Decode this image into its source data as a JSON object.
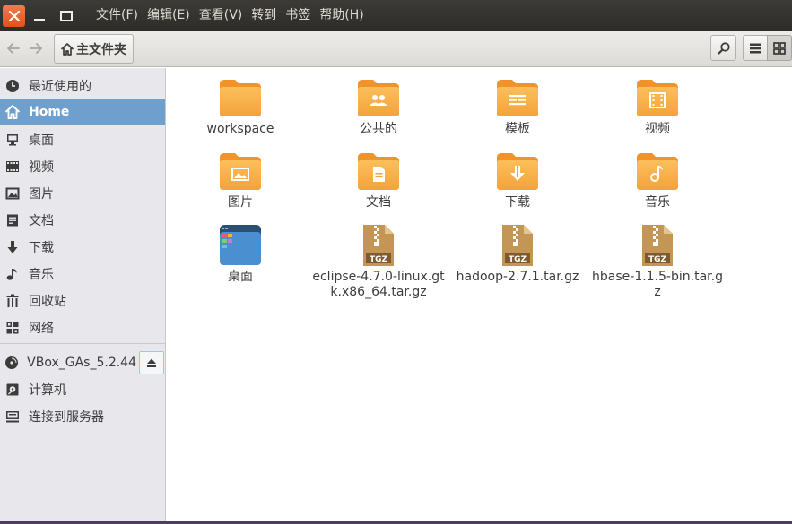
{
  "menubar": {
    "items": [
      "文件(F)",
      "编辑(E)",
      "查看(V)",
      "转到",
      "书签",
      "帮助(H)"
    ]
  },
  "toolbar": {
    "path_label": "主文件夹"
  },
  "sidebar": {
    "items": [
      {
        "label": "最近使用的",
        "icon": "clock-icon"
      },
      {
        "label": "Home",
        "icon": "home-icon",
        "active": true
      },
      {
        "label": "桌面",
        "icon": "desktop-icon"
      },
      {
        "label": "视频",
        "icon": "film-icon"
      },
      {
        "label": "图片",
        "icon": "picture-icon"
      },
      {
        "label": "文档",
        "icon": "document-icon"
      },
      {
        "label": "下载",
        "icon": "download-arrow-icon"
      },
      {
        "label": "音乐",
        "icon": "music-note-icon"
      },
      {
        "label": "回收站",
        "icon": "trash-icon"
      },
      {
        "label": "网络",
        "icon": "network-icon"
      },
      {
        "label": "VBox_GAs_5.2.44",
        "icon": "disc-icon"
      },
      {
        "label": "计算机",
        "icon": "computer-icon"
      },
      {
        "label": "连接到服务器",
        "icon": "server-icon"
      }
    ]
  },
  "files": [
    {
      "name": "workspace",
      "type": "folder",
      "emblem": "none"
    },
    {
      "name": "公共的",
      "type": "folder",
      "emblem": "people"
    },
    {
      "name": "模板",
      "type": "folder",
      "emblem": "template"
    },
    {
      "name": "视频",
      "type": "folder",
      "emblem": "video"
    },
    {
      "name": "图片",
      "type": "folder",
      "emblem": "picture"
    },
    {
      "name": "文档",
      "type": "folder",
      "emblem": "document"
    },
    {
      "name": "下载",
      "type": "folder",
      "emblem": "download"
    },
    {
      "name": "音乐",
      "type": "folder",
      "emblem": "music"
    },
    {
      "name": "桌面",
      "type": "desktop-folder",
      "emblem": "desktop"
    },
    {
      "name": "eclipse-4.7.0-linux.gtk.x86_64.tar.gz",
      "type": "archive",
      "badge": "TGZ"
    },
    {
      "name": "hadoop-2.7.1.tar.gz",
      "type": "archive",
      "badge": "TGZ"
    },
    {
      "name": "hbase-1.1.5-bin.tar.gz",
      "type": "archive",
      "badge": "TGZ"
    }
  ],
  "colors": {
    "titlebar": "#3c3b37",
    "close_button": "#e95420",
    "folder": "#f7a23b",
    "folder_light": "#fbc86a",
    "archive": "#b98a4e",
    "sidebar_active": "#6e9fcd"
  }
}
